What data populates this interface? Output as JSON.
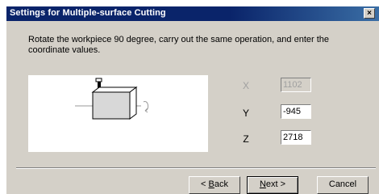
{
  "window": {
    "title": "Settings for Multiple-surface Cutting",
    "close_label": "×"
  },
  "instruction": "Rotate the workpiece 90 degree, carry out the same operation, and enter the coordinate values.",
  "coordinates": {
    "x": {
      "label": "X",
      "value": "1102",
      "enabled": false
    },
    "y": {
      "label": "Y",
      "value": "-945",
      "enabled": true
    },
    "z": {
      "label": "Z",
      "value": "2718",
      "enabled": true
    }
  },
  "buttons": {
    "back": {
      "prefix": "< ",
      "mnemonic": "B",
      "rest": "ack"
    },
    "next": {
      "mnemonic": "N",
      "rest": "ext >"
    },
    "cancel": "Cancel"
  },
  "colors": {
    "titlebar": "#0a246a",
    "dialog_bg": "#d4d0c8",
    "disabled_text": "#a0a0a0"
  }
}
